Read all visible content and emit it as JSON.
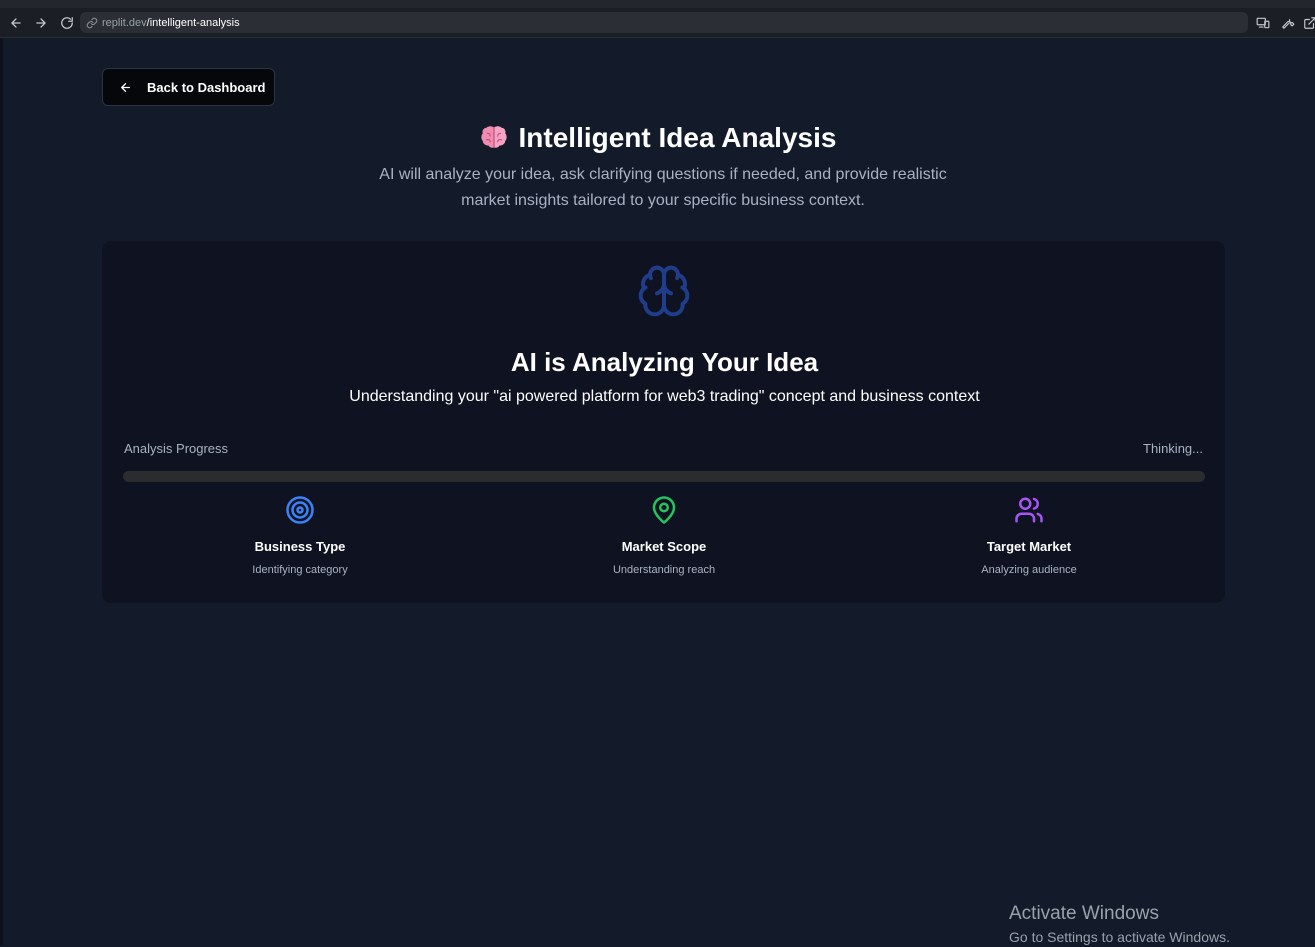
{
  "browser": {
    "url_host": "replit.dev",
    "url_path": "/intelligent-analysis"
  },
  "back_button": {
    "label": "Back to Dashboard"
  },
  "header": {
    "title": "Intelligent Idea Analysis",
    "emoji": "brain-emoji",
    "subtitle": "AI will analyze your idea, ask clarifying questions if needed, and provide realistic market insights tailored to your specific business context."
  },
  "analysis": {
    "icon": "brain-icon",
    "title": "AI is Analyzing Your Idea",
    "context": "Understanding your \"ai powered platform for web3 trading\" concept and business context",
    "progress_label": "Analysis Progress",
    "progress_status": "Thinking...",
    "progress_value": 0,
    "steps": [
      {
        "name": "Business Type",
        "desc": "Identifying category",
        "icon": "target-icon",
        "color": "#3b82f6"
      },
      {
        "name": "Market Scope",
        "desc": "Understanding reach",
        "icon": "map-pin-icon",
        "color": "#22c55e"
      },
      {
        "name": "Target Market",
        "desc": "Analyzing audience",
        "icon": "users-icon",
        "color": "#a855f7"
      }
    ]
  },
  "watermark": {
    "line1": "Activate Windows",
    "line2": "Go to Settings to activate Windows."
  },
  "colors": {
    "background": "#131a2a",
    "card": "#0f1321",
    "brain_icon": "#1f3d8a",
    "progress_track": "#2a2c30"
  }
}
